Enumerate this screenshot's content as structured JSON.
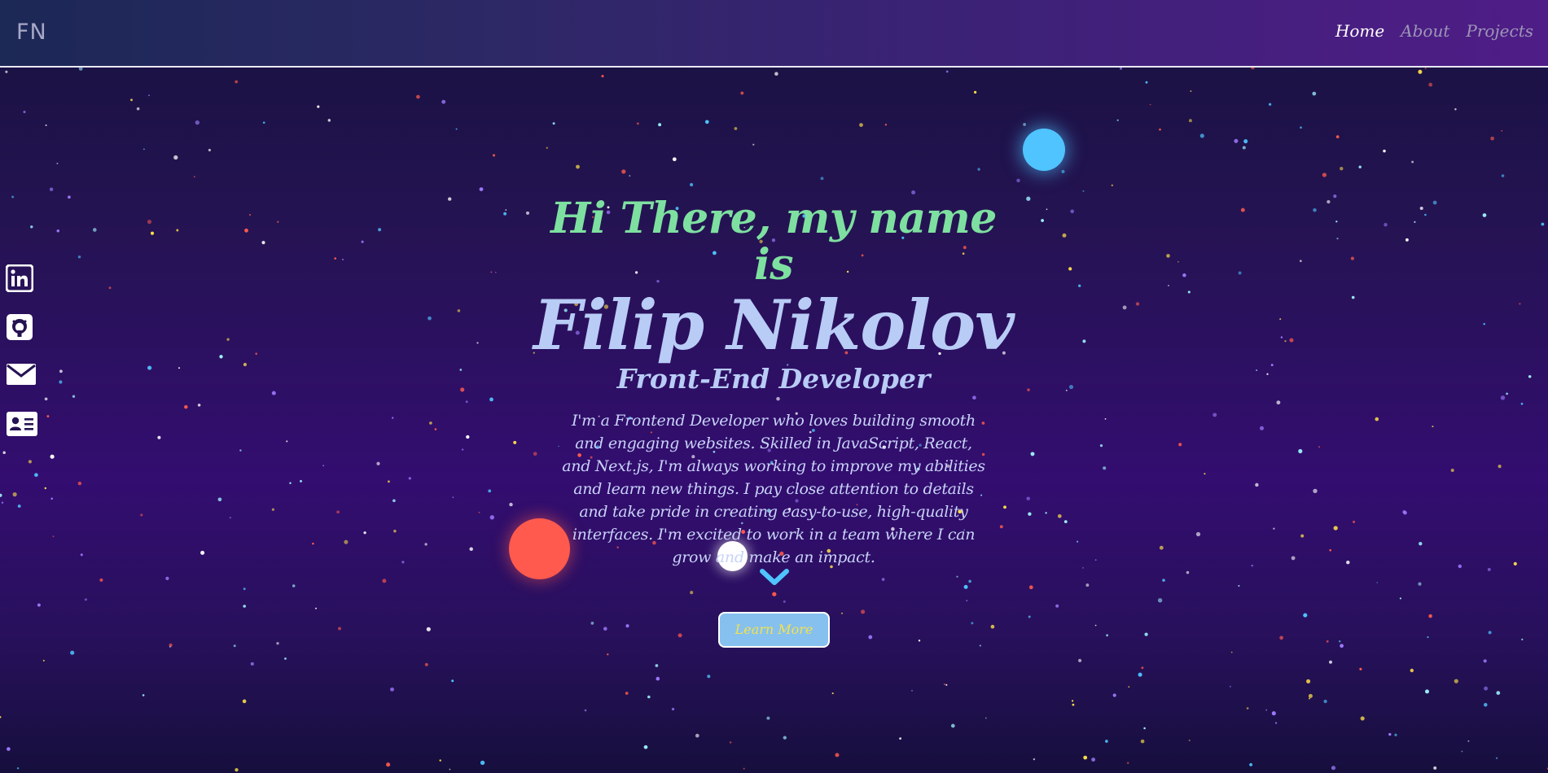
{
  "nav": {
    "logo": "FN",
    "links": [
      "Home",
      "About",
      "Projects"
    ],
    "active": "Home"
  },
  "social": [
    {
      "icon": "linkedin-icon"
    },
    {
      "icon": "github-icon"
    },
    {
      "icon": "email-icon"
    },
    {
      "icon": "contact-card-icon"
    }
  ],
  "hero": {
    "greeting": "Hi There, my name is",
    "name": "Filip Nikolov",
    "role": "Front-End Developer",
    "bio": "I'm a Frontend Developer who loves building smooth and engaging websites. Skilled in JavaScript, React, and Next.js, I'm always working to improve my abilities and learn new things. I pay close attention to details and take pride in creating easy-to-use, high-quality interfaces. I'm excited to work in a team where I can grow and make an impact.",
    "scroll_icon": "chevron-down-icon",
    "cta_label": "Learn More"
  },
  "colors": {
    "greeting": "#7ee0a0",
    "name": "#b8ccf6",
    "button_bg": "#86c0ee",
    "button_text": "#f3e24e",
    "planet_blue": "#4fc4ff",
    "planet_red": "#ff5a4d",
    "planet_white": "#ffffff",
    "star_colors": [
      "#ffffff",
      "#ffe14a",
      "#ff5a4d",
      "#4fc4ff",
      "#9f7bff",
      "#9ff5ff"
    ]
  }
}
